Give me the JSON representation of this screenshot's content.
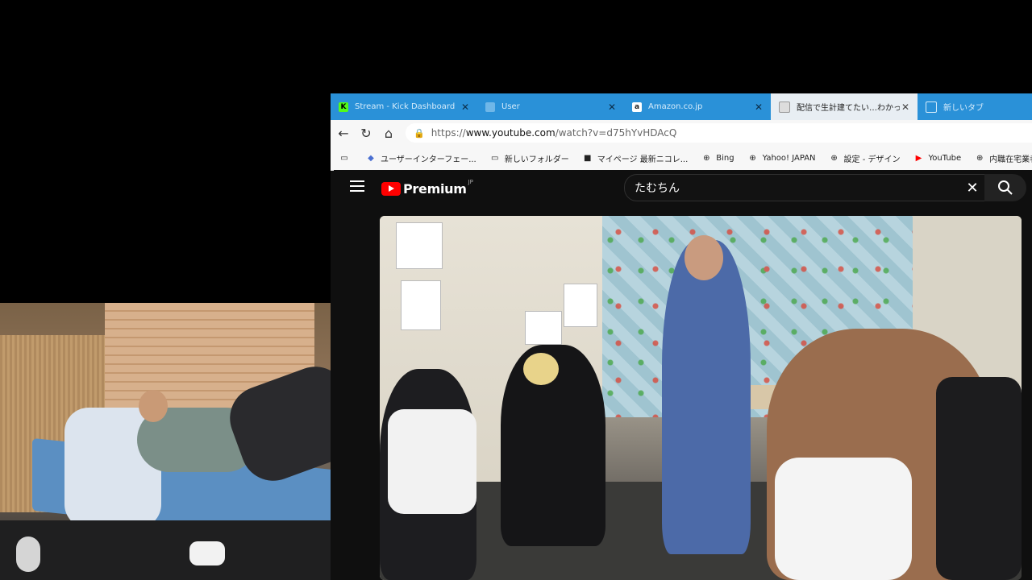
{
  "tabs": [
    {
      "label": "Stream - Kick Dashboard",
      "favicon": "K",
      "color": "#53fc18",
      "active": false
    },
    {
      "label": "User",
      "favicon": "",
      "color": "#6fb7e8",
      "active": false
    },
    {
      "label": "Amazon.co.jp",
      "favicon": "a",
      "color": "#ffffff",
      "active": false
    },
    {
      "label": "配信で生計建てたい…わかってんの",
      "favicon": "",
      "color": "#e8eef3",
      "active": true
    },
    {
      "label": "新しいタブ",
      "favicon": "",
      "color": "#d6ecfb",
      "active": false
    }
  ],
  "address": {
    "prefix": "https://",
    "host": "www.youtube.com",
    "path": "/watch?v=d75hYvHDAcQ"
  },
  "bookmarks": [
    {
      "label": "ユーザーインターフェー...",
      "icon": "shield-icon"
    },
    {
      "label": "新しいフォルダー",
      "icon": "folder-icon"
    },
    {
      "label": "マイページ 最新ニコレ...",
      "icon": "niconico-icon"
    },
    {
      "label": "Bing",
      "icon": "globe-icon"
    },
    {
      "label": "Yahoo! JAPAN",
      "icon": "globe-icon"
    },
    {
      "label": "設定 - デザイン",
      "icon": "globe-icon"
    },
    {
      "label": "YouTube",
      "icon": "youtube-icon"
    },
    {
      "label": "内職在宅業者名 - Go...",
      "icon": "globe-icon"
    }
  ],
  "youtube": {
    "brand": "Premium",
    "region": "JP",
    "search_query": "たむちん"
  },
  "colors": {
    "tabbar": "#2a91d8",
    "youtube_red": "#ff0000",
    "page_bg": "#0f0f0f"
  }
}
